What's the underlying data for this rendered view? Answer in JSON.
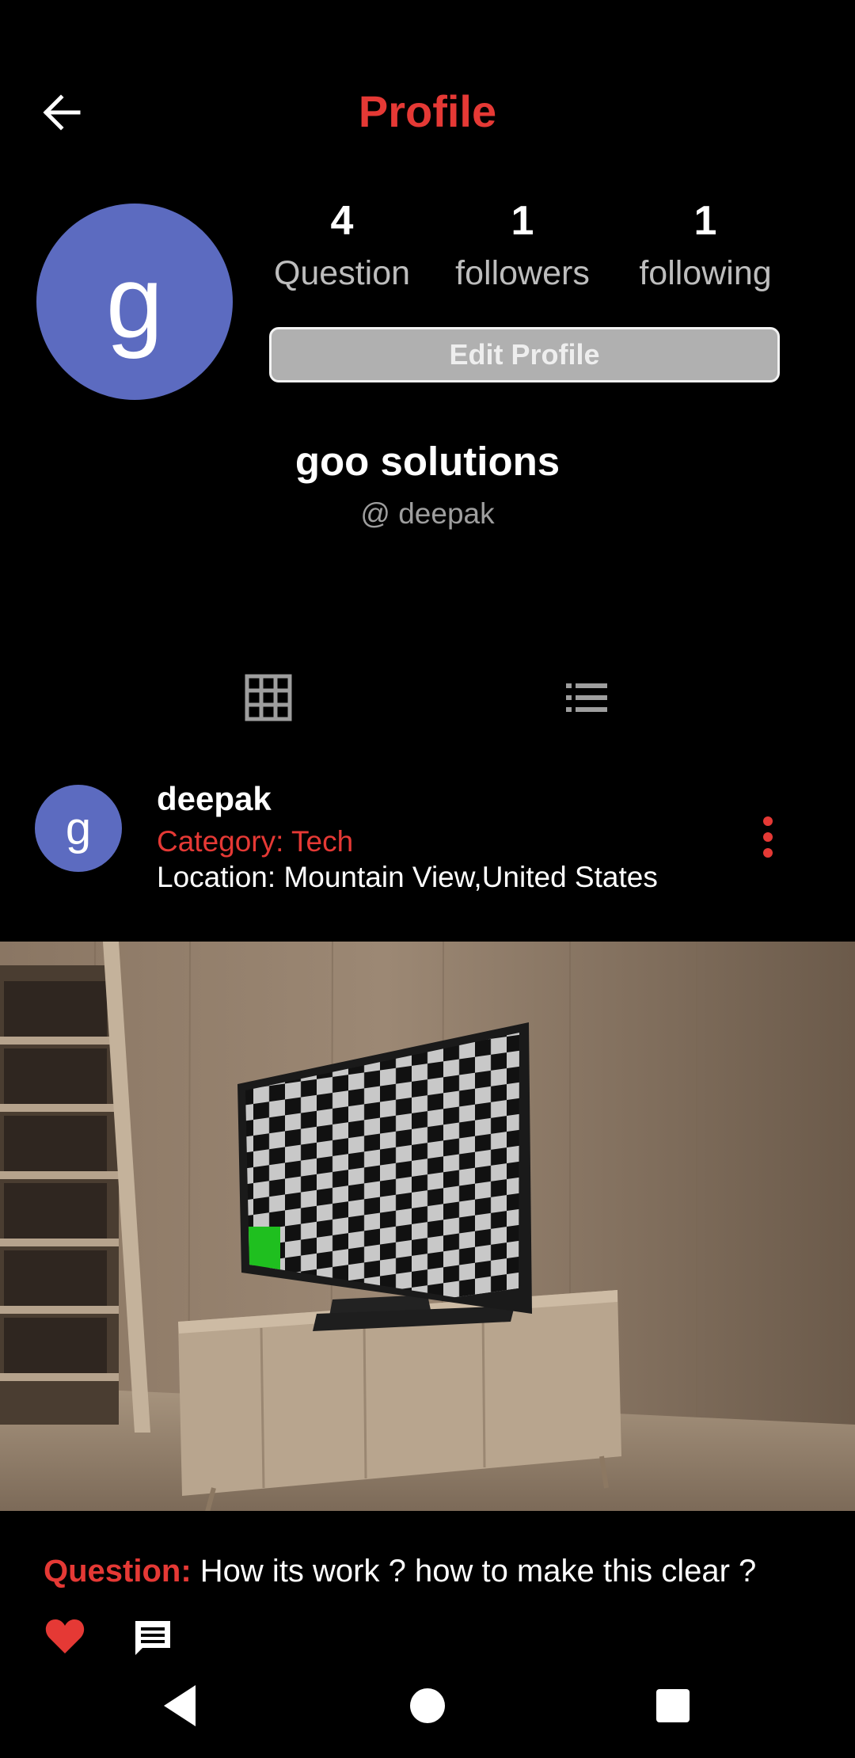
{
  "header": {
    "title": "Profile",
    "back_icon": "arrow-left-icon"
  },
  "profile": {
    "avatar_letter": "g",
    "avatar_color": "#5c6bc0",
    "stats": [
      {
        "value": "4",
        "label": "Question"
      },
      {
        "value": "1",
        "label": "followers"
      },
      {
        "value": "1",
        "label": "following"
      }
    ],
    "edit_button_label": "Edit Profile",
    "display_name": "goo solutions",
    "handle": "@ deepak"
  },
  "tabs": [
    {
      "icon": "grid-icon",
      "selected": false
    },
    {
      "icon": "list-icon",
      "selected": true
    }
  ],
  "post": {
    "avatar_letter": "g",
    "username": "deepak",
    "category": "Category: Tech",
    "location": "Location: Mountain View,United States",
    "question_label": "Question:",
    "question_text": "How its work ? how to make this clear ?",
    "liked": true
  },
  "colors": {
    "accent": "#e53935",
    "background": "#000000",
    "avatar": "#5c6bc0"
  }
}
